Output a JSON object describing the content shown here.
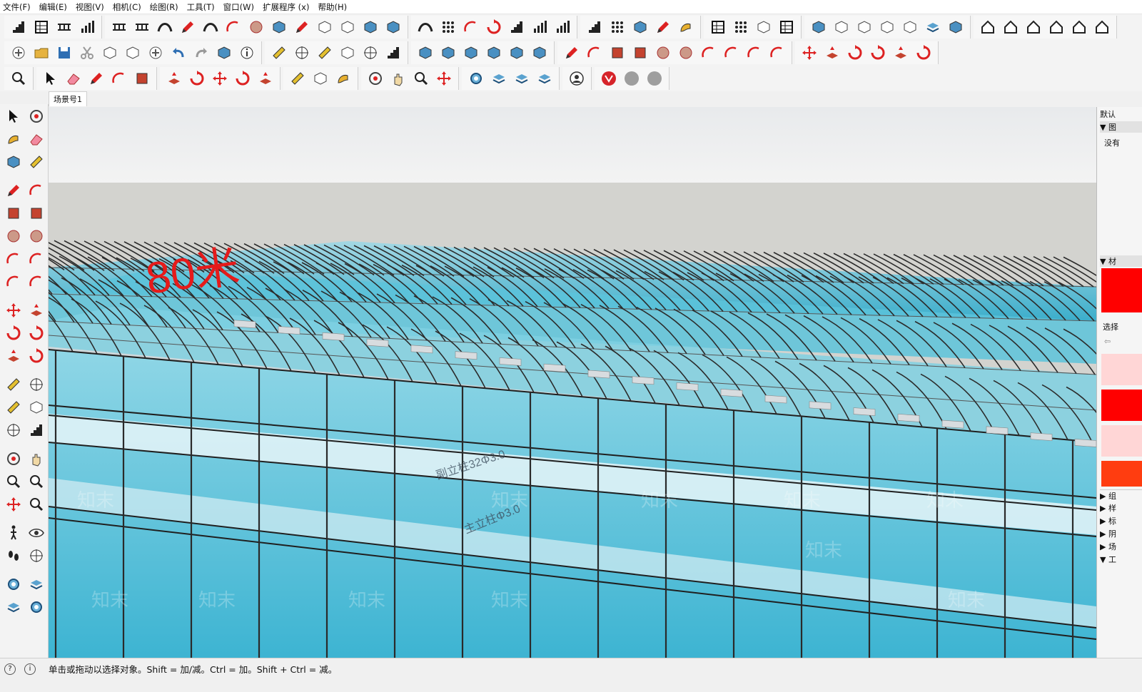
{
  "menu": [
    "文件(F)",
    "编辑(E)",
    "视图(V)",
    "相机(C)",
    "绘图(R)",
    "工具(T)",
    "窗口(W)",
    "扩展程序 (x)",
    "帮助(H)"
  ],
  "scene_tab": "场景号1",
  "viewport": {
    "label_80m": "80米",
    "annot_1": "副立柱32Φ3.0",
    "annot_2": "主立柱Φ3.0",
    "watermark": "知末"
  },
  "right_panel": {
    "title": "默认",
    "section1": "▼ 图",
    "section1_value": "没有",
    "section2": "▼ 材",
    "select_label": "选择",
    "collapsed": [
      "▶ 组",
      "▶ 样",
      "▶ 标",
      "▶ 阴",
      "▶ 场",
      "▼ 工"
    ]
  },
  "status": {
    "text": "单击或拖动以选择对象。Shift = 加/减。Ctrl = 加。Shift + Ctrl = 减。"
  },
  "colors": {
    "glass": "#5cc6dc",
    "frame": "#2b2b2b",
    "label_red": "#e51b1b",
    "swatch_red": "#ff0000",
    "swatch_pink": "#ffd6d6",
    "swatch_orange": "#ff3d10"
  }
}
